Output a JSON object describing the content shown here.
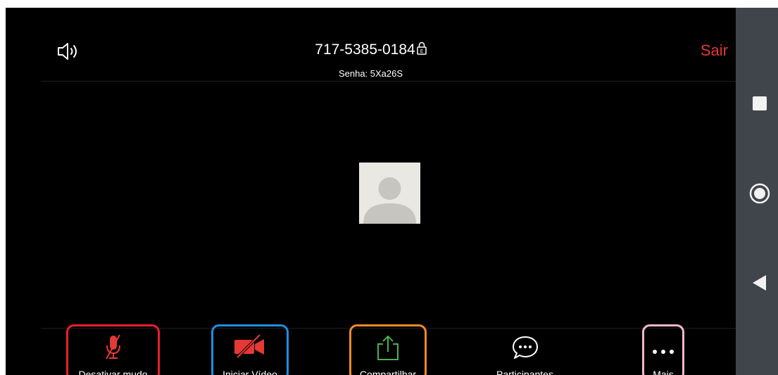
{
  "header": {
    "meeting_id": "717-5385-0184",
    "password": "Senha: 5Xa26S",
    "leave_label": "Sair"
  },
  "toolbar": {
    "unmute_label": "Desativar mudo",
    "video_label": "Iniciar Vídeo",
    "share_label": "Compartilhar",
    "participants_label": "Participantes",
    "more_label": "Mais"
  },
  "icons": {
    "speaker": "speaker-icon",
    "lock": "lock-encrypted-icon",
    "avatar": "default-user-avatar",
    "mic_muted": "microphone-muted-icon",
    "video_off": "video-off-icon",
    "share": "share-upload-icon",
    "participants": "chat-bubble-icon",
    "more": "ellipsis-icon",
    "nav_recent": "square-icon",
    "nav_home": "circle-icon",
    "nav_back": "triangle-back-icon"
  },
  "colors": {
    "background": "#000000",
    "leave": "#e53935",
    "muted_red": "#e53935",
    "share_green": "#4caf50",
    "highlight_unmute": "#e8202a",
    "highlight_video": "#1e8ee0",
    "highlight_share": "#f08a24",
    "highlight_more": "#f2b8c8",
    "nav_bar": "#3f454b"
  }
}
